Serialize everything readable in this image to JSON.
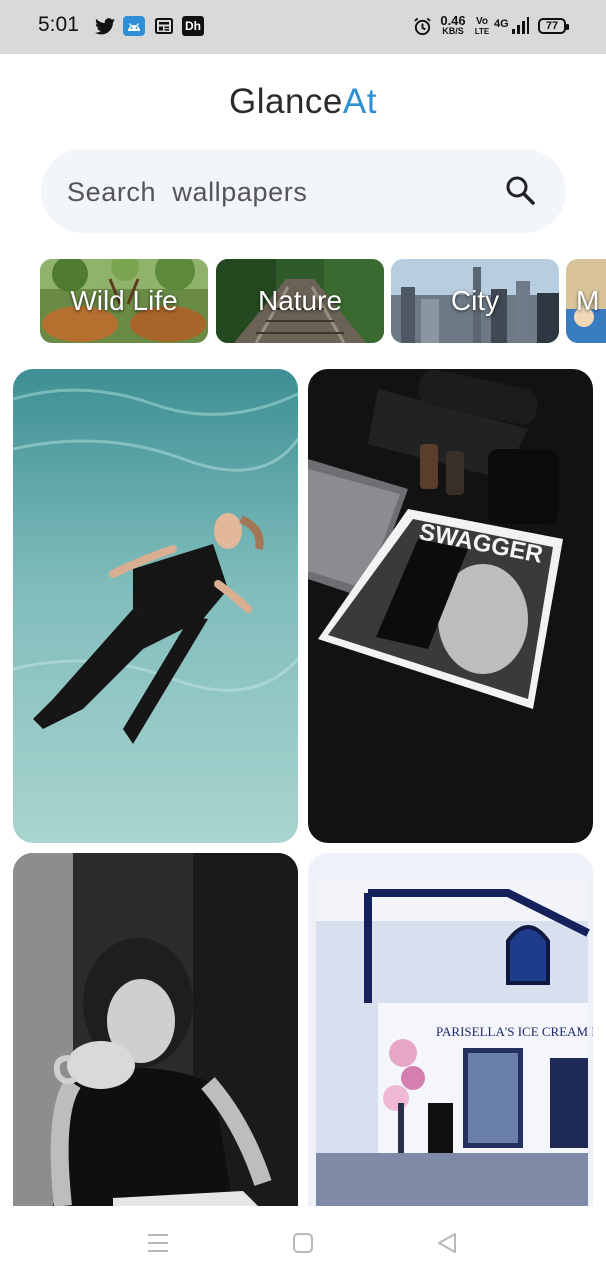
{
  "status_bar": {
    "time": "5:01",
    "icons": [
      "twitter-icon",
      "android-debug-icon",
      "news-icon",
      "dh-app-icon"
    ],
    "dh_label": "Dh",
    "net_speed": "0.46",
    "net_unit": "KB/S",
    "volte_top": "Vo",
    "volte_bottom": "LTE",
    "network": "4G",
    "battery": "77"
  },
  "header": {
    "title_part1": "Glance",
    "title_part2": "At"
  },
  "search": {
    "placeholder": "Search  wallpapers",
    "icon": "search-icon"
  },
  "categories": [
    {
      "label": "Wild Life"
    },
    {
      "label": "Nature"
    },
    {
      "label": "City"
    },
    {
      "label": "M"
    }
  ],
  "wallpapers": [
    {
      "subject": "woman floating in pool"
    },
    {
      "subject": "swagger magazine on desk"
    },
    {
      "subject": "woman with coffee cup"
    },
    {
      "subject": "ice cream shop storefront"
    }
  ],
  "storefront_sign": "PARISELLA'S ICE CREAM DA",
  "nav": {
    "items": [
      "menu-icon",
      "home-icon",
      "back-icon"
    ]
  },
  "colors": {
    "accent": "#2f8fd6",
    "search_bg": "#f2f5fa",
    "status_bg": "#d9d9d9"
  }
}
